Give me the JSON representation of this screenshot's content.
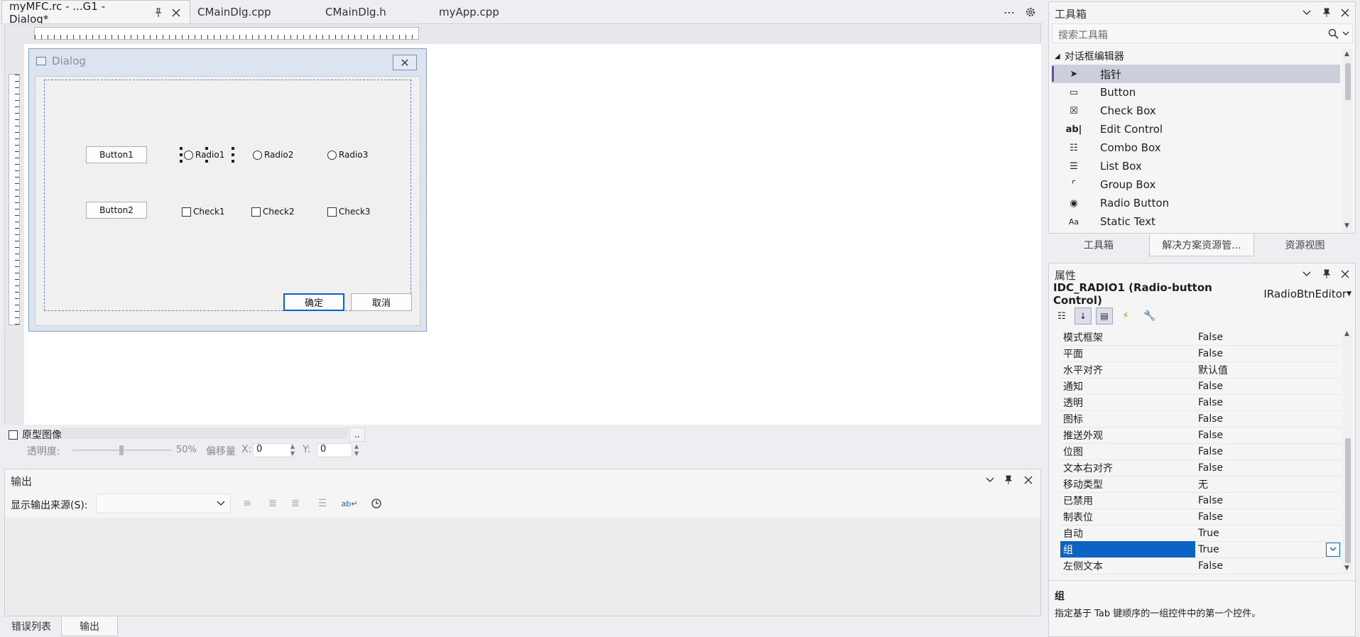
{
  "tabs": [
    {
      "label": "myMFC.rc - ...G1 - Dialog*",
      "active": true
    },
    {
      "label": "CMainDlg.cpp",
      "active": false
    },
    {
      "label": "CMainDlg.h",
      "active": false
    },
    {
      "label": "myApp.cpp",
      "active": false
    }
  ],
  "tab_tools": {
    "overflow": "⋯",
    "settings": "⚙",
    "pin": "📌",
    "close": "✕"
  },
  "dialog": {
    "title": "Dialog",
    "close_glyph": "✕",
    "buttons": [
      {
        "label": "Button1"
      },
      {
        "label": "Button2"
      }
    ],
    "radios": [
      {
        "label": "Radio1"
      },
      {
        "label": "Radio2"
      },
      {
        "label": "Radio3"
      }
    ],
    "checks": [
      {
        "label": "Check1"
      },
      {
        "label": "Check2"
      },
      {
        "label": "Check3"
      }
    ],
    "ok_label": "确定",
    "cancel_label": "取消"
  },
  "proto": {
    "checkbox_label": "原型图像:",
    "browse_label": "..",
    "opacity_label": "透明度:",
    "opacity_value": "50%",
    "offset_label": "偏移量",
    "x_label": "X:",
    "x_value": "0",
    "y_label": "Y:",
    "y_value": "0"
  },
  "output": {
    "title": "输出",
    "source_label": "显示输出来源(S):",
    "source_value": ""
  },
  "bottom_tabs": [
    {
      "label": "错误列表",
      "active": false
    },
    {
      "label": "输出",
      "active": true
    }
  ],
  "toolbox": {
    "title": "工具箱",
    "search_placeholder": "搜索工具箱",
    "group": "对话框编辑器",
    "items": [
      {
        "label": "指针",
        "icon": "pointer-icon",
        "glyph": "➤",
        "selected": true
      },
      {
        "label": "Button",
        "icon": "button-icon",
        "glyph": "▭",
        "selected": false
      },
      {
        "label": "Check Box",
        "icon": "check-box-icon",
        "glyph": "☒",
        "selected": false
      },
      {
        "label": "Edit Control",
        "icon": "edit-control-icon",
        "glyph": "ab|",
        "selected": false
      },
      {
        "label": "Combo Box",
        "icon": "combo-box-icon",
        "glyph": "☷",
        "selected": false
      },
      {
        "label": "List Box",
        "icon": "list-box-icon",
        "glyph": "☰",
        "selected": false
      },
      {
        "label": "Group Box",
        "icon": "group-box-icon",
        "glyph": "⌜",
        "selected": false
      },
      {
        "label": "Radio Button",
        "icon": "radio-button-icon",
        "glyph": "◉",
        "selected": false
      },
      {
        "label": "Static Text",
        "icon": "static-text-icon",
        "glyph": "Aa",
        "selected": false
      }
    ]
  },
  "mid_tabs": [
    {
      "label": "工具箱",
      "active": false
    },
    {
      "label": "解决方案资源管...",
      "active": true
    },
    {
      "label": "资源视图",
      "active": false
    }
  ],
  "properties": {
    "title": "属性",
    "object_name": "IDC_RADIO1 (Radio-button Control)",
    "object_editor": "IRadioBtnEditor",
    "rows": [
      {
        "name": "模式框架",
        "value": "False"
      },
      {
        "name": "平面",
        "value": "False"
      },
      {
        "name": "水平对齐",
        "value": "默认值"
      },
      {
        "name": "通知",
        "value": "False"
      },
      {
        "name": "透明",
        "value": "False"
      },
      {
        "name": "图标",
        "value": "False"
      },
      {
        "name": "推送外观",
        "value": "False"
      },
      {
        "name": "位图",
        "value": "False"
      },
      {
        "name": "文本右对齐",
        "value": "False"
      },
      {
        "name": "移动类型",
        "value": "无"
      },
      {
        "name": "已禁用",
        "value": "False"
      },
      {
        "name": "制表位",
        "value": "False"
      },
      {
        "name": "自动",
        "value": "True"
      },
      {
        "name": "组",
        "value": "True",
        "selected": true
      },
      {
        "name": "左侧文本",
        "value": "False"
      }
    ],
    "desc_title": "组",
    "desc_text": "指定基于 Tab 键顺序的一组控件中的第一个控件。"
  }
}
